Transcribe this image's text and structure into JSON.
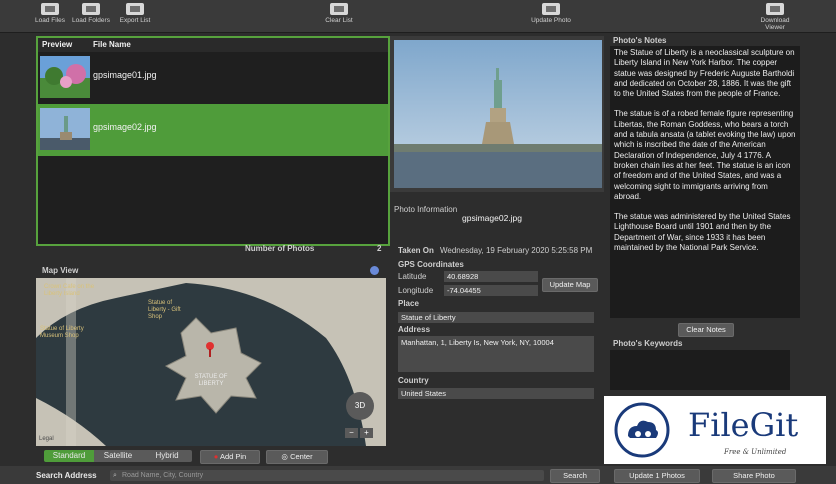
{
  "toolbar": {
    "load_files": "Load Files",
    "load_folders": "Load Folders",
    "export_list": "Export List",
    "clear_list": "Clear List",
    "update_photo": "Update Photo",
    "download_viewer": "Download Viewer"
  },
  "list": {
    "col_preview": "Preview",
    "col_file": "File Name",
    "rows": [
      {
        "name": "gpsimage01.jpg",
        "selected": false
      },
      {
        "name": "gpsimage02.jpg",
        "selected": true
      }
    ],
    "count_label": "Number of Photos",
    "count": "2"
  },
  "map": {
    "title": "Map View",
    "poi1": "Crown Cafe on the Liberty Island",
    "poi2": "Statue of Liberty - Gift Shop",
    "poi3": "Statue of Liberty Museum Shop",
    "center_label": "STATUE OF LIBERTY",
    "zoom_3d": "3D",
    "legal": "Legal",
    "modes": [
      "Standard",
      "Satellite",
      "Hybrid"
    ],
    "active_mode": "Standard",
    "add_pin": "Add Pin",
    "center": "Center"
  },
  "info": {
    "title": "Photo Information",
    "filename": "gpsimage02.jpg",
    "taken_on_label": "Taken On",
    "taken_on": "Wednesday, 19 February 2020 5:25:58 PM",
    "gps_label": "GPS Coordinates",
    "lat_label": "Latitude",
    "lat": "40.68928",
    "lon_label": "Longitude",
    "lon": "-74.04455",
    "update_map": "Update Map",
    "place_label": "Place",
    "place": "Statue of Liberty",
    "address_label": "Address",
    "address": "Manhattan, 1, Liberty Is, New York, NY, 10004",
    "country_label": "Country",
    "country": "United States"
  },
  "notes": {
    "title": "Photo's Notes",
    "p1": "The Statue of Liberty is a neoclassical sculpture on Liberty Island in New York Harbor. The copper statue was designed by Frederic Auguste Bartholdi and dedicated on October 28, 1886. It was the gift to the United States from the people of France.",
    "p2": "The statue is of a robed female figure representing Libertas, the Roman Goddess, who bears a torch and a tabula ansata (a tablet evoking the law) upon which is inscribed the date of the American Declaration of Independence, July 4 1776. A broken chain lies at her feet. The statue is an icon of freedom and of the United States, and was a welcoming sight to immigrants arriving from abroad.",
    "p3": "The statue was administered by the United States Lighthouse Board until 1901 and then by the Department of War, since 1933 it has been maintained by the National Park Service.",
    "clear_notes": "Clear Notes",
    "keywords_title": "Photo's Keywords"
  },
  "bottom": {
    "search_label": "Search Address",
    "search_placeholder": "Road Name, City, Country",
    "search_btn": "Search",
    "update_btn": "Update 1 Photos",
    "share_btn": "Share Photo"
  },
  "logo": {
    "name": "FileGit",
    "tagline": "Free & Unlimited"
  },
  "colors": {
    "selection": "#4f9c3a",
    "accent_blue": "#1a3a7a"
  }
}
